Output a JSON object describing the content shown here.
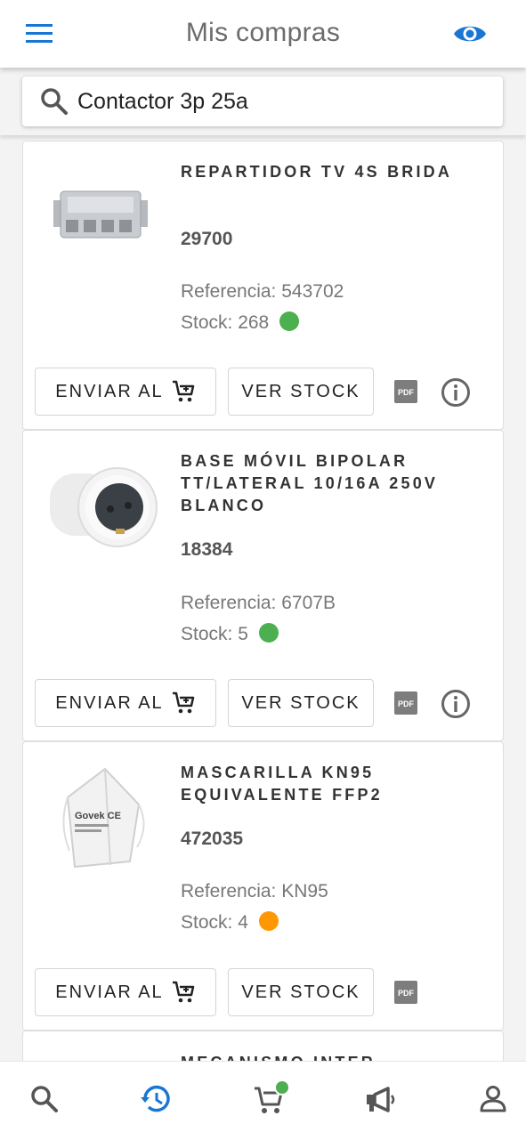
{
  "header": {
    "title": "Mis compras",
    "menu_icon": "menu-icon",
    "eye_icon": "eye-icon"
  },
  "search": {
    "value": "Contactor 3p 25a",
    "icon": "search-icon"
  },
  "actions": {
    "send_label": "ENVIAR AL",
    "stock_label": "VER STOCK",
    "pdf_icon": "pdf-icon",
    "info_icon": "info-icon"
  },
  "products": [
    {
      "name": "REPARTIDOR TV 4S BRIDA",
      "code": "29700",
      "reference": "Referencia: 543702",
      "stock": "Stock: 268",
      "stock_color": "#4caf50",
      "image": "tv-splitter-image",
      "has_info": true
    },
    {
      "name": "BASE MÓVIL BIPOLAR TT/LATERAL 10/16A 250V BLANCO",
      "code": "18384",
      "reference": "Referencia: 6707B",
      "stock": "Stock: 5",
      "stock_color": "#4caf50",
      "image": "socket-base-image",
      "has_info": true
    },
    {
      "name": "MASCARILLA KN95 EQUIVALENTE FFP2",
      "code": "472035",
      "reference": "Referencia: KN95",
      "stock": "Stock: 4",
      "stock_color": "#ff9800",
      "image": "kn95-mask-image",
      "has_info": false
    },
    {
      "name": "MECANISMO INTER",
      "image": "mechanism-image"
    }
  ],
  "mask_text": "Govek CE",
  "bottom_nav": {
    "items": [
      "search-icon",
      "history-icon",
      "cart-icon",
      "megaphone-icon",
      "user-icon"
    ],
    "active_color": "#1976d2",
    "badge_color": "#4caf50"
  }
}
